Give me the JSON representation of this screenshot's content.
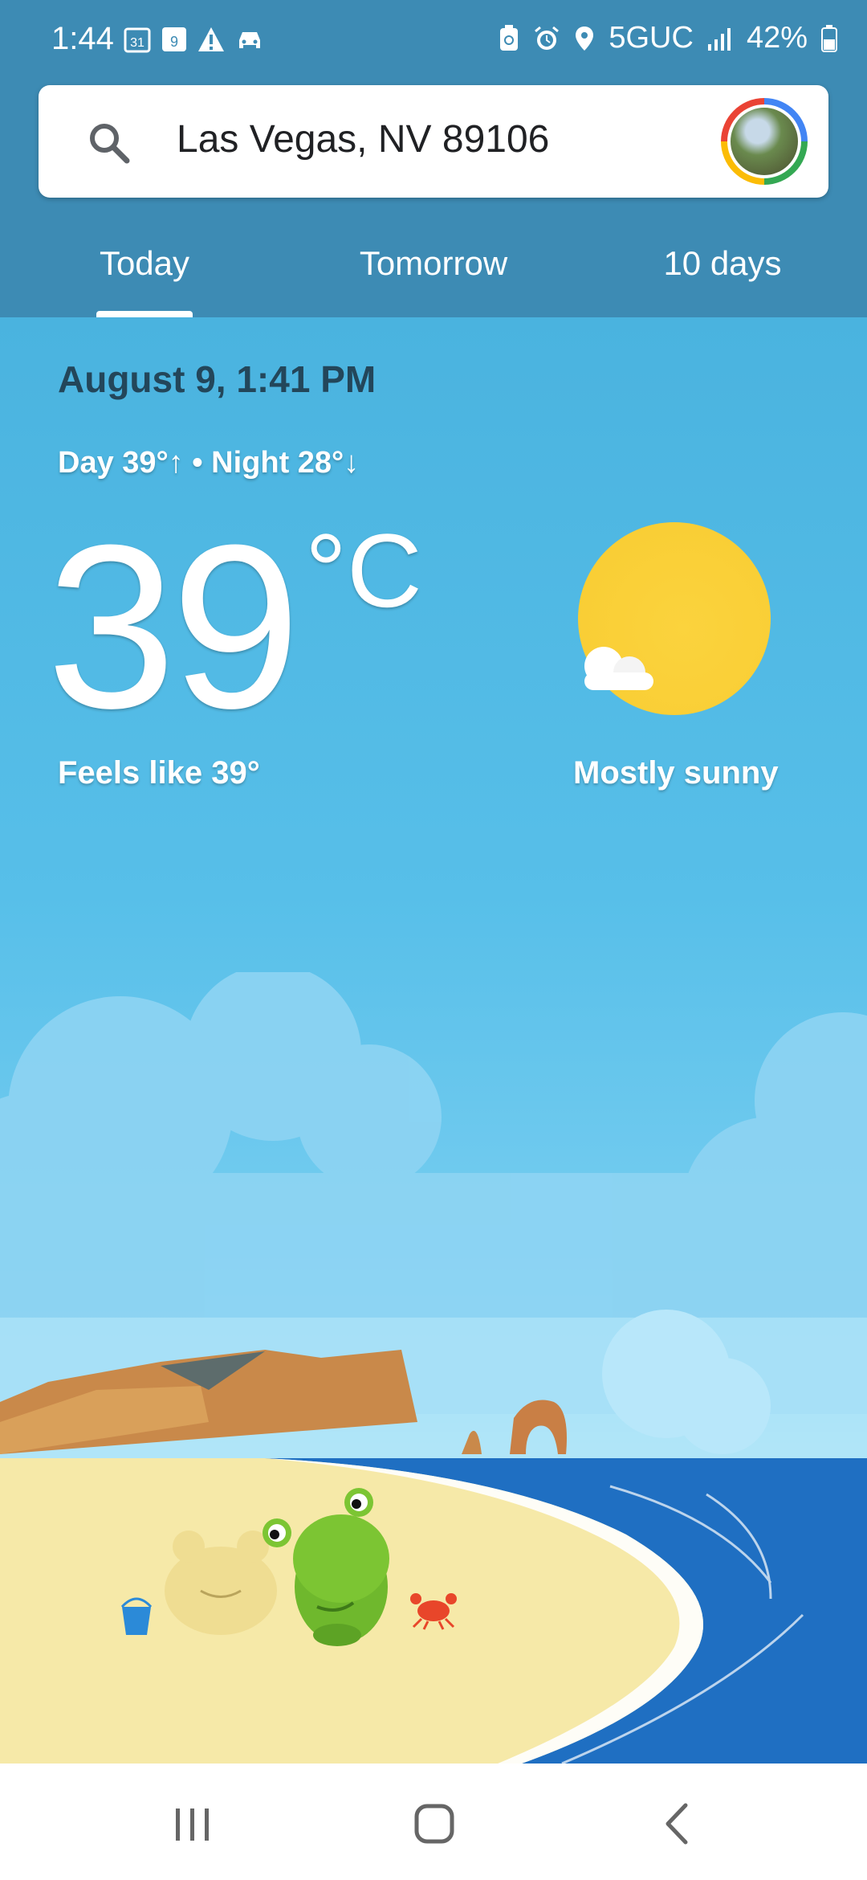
{
  "status_bar": {
    "time": "1:44",
    "network": "5GUC",
    "battery": "42%",
    "icons": [
      "calendar-icon",
      "notification-icon",
      "warning-icon",
      "car-icon",
      "battery-saver-icon",
      "alarm-icon",
      "location-icon",
      "signal-icon",
      "battery-icon"
    ],
    "calendar_day": "31",
    "notification_badge": "9"
  },
  "search": {
    "location": "Las Vegas, NV 89106",
    "icon": "search-icon"
  },
  "tabs": [
    {
      "label": "Today",
      "active": true
    },
    {
      "label": "Tomorrow",
      "active": false
    },
    {
      "label": "10 days",
      "active": false
    }
  ],
  "weather": {
    "date": "August 9, 1:41 PM",
    "day_night": "Day 39°↑ • Night 28°↓",
    "temperature": "39",
    "unit": "°C",
    "feels_like": "Feels like 39°",
    "condition": "Mostly sunny",
    "condition_icon": "mostly-sunny-icon"
  },
  "nav": {
    "recents": "recents-icon",
    "home": "home-icon",
    "back": "back-icon"
  },
  "colors": {
    "header": "#3d8bb4",
    "sky": "#4ab6df",
    "sun": "#f8cc32",
    "sea": "#1f6fc2",
    "sand": "#f6e9a8"
  }
}
